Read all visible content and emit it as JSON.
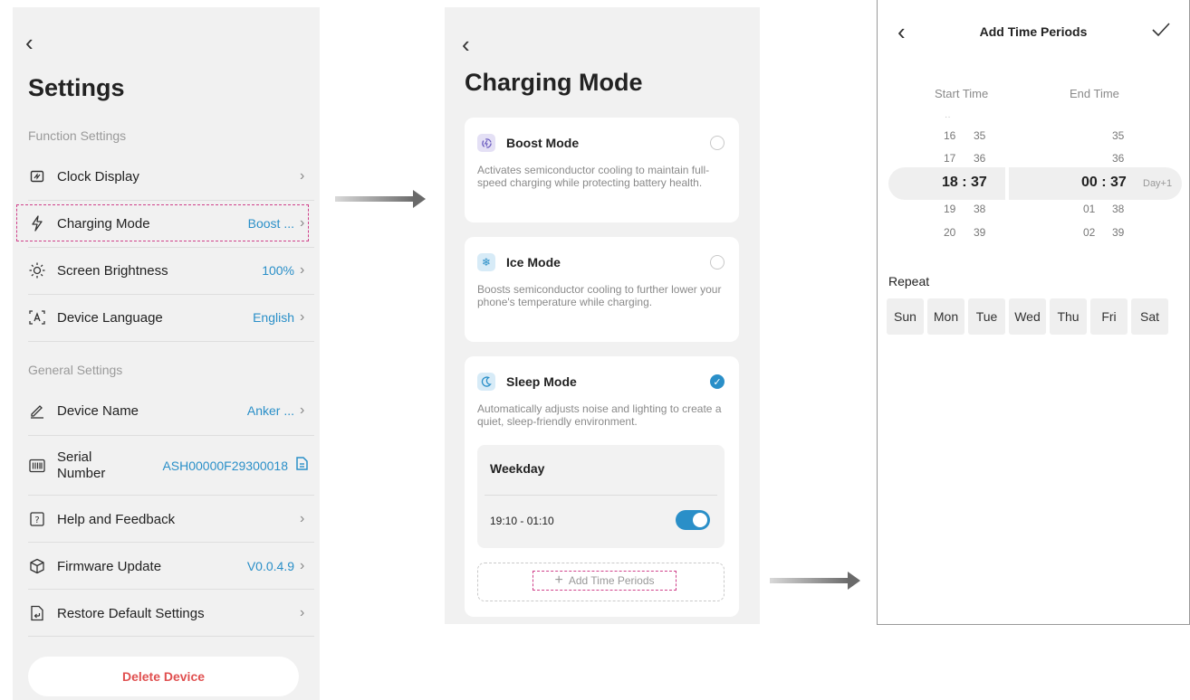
{
  "settings": {
    "title": "Settings",
    "function_section": "Function Settings",
    "general_section": "General Settings",
    "items": [
      {
        "label": "Clock Display",
        "value": ""
      },
      {
        "label": "Charging Mode",
        "value": "Boost ..."
      },
      {
        "label": "Screen Brightness",
        "value": "100%"
      },
      {
        "label": "Device Language",
        "value": "English"
      },
      {
        "label": "Device Name",
        "value": "Anker ..."
      },
      {
        "label_line1": "Serial",
        "label_line2": "Number",
        "value": "ASH00000F29300018"
      },
      {
        "label": "Help and Feedback",
        "value": ""
      },
      {
        "label": "Firmware Update",
        "value": "V0.0.4.9"
      },
      {
        "label": "Restore Default Settings",
        "value": ""
      }
    ],
    "delete_label": "Delete Device"
  },
  "charging": {
    "title": "Charging Mode",
    "modes": [
      {
        "title": "Boost Mode",
        "desc": "Activates semiconductor cooling to maintain full-speed charging while protecting battery health.",
        "selected": false
      },
      {
        "title": "Ice Mode",
        "desc": "Boosts semiconductor cooling to further lower your phone's temperature while charging.",
        "selected": false
      },
      {
        "title": "Sleep Mode",
        "desc": "Automatically adjusts noise and lighting to create a quiet, sleep-friendly environment.",
        "selected": true
      }
    ],
    "schedule": {
      "day": "Weekday",
      "time": "19:10 - 01:10",
      "enabled": true
    },
    "add_label": "Add Time Periods"
  },
  "periods": {
    "title": "Add Time Periods",
    "start_label": "Start Time",
    "end_label": "End Time",
    "start_hours": [
      "16",
      "17",
      "19",
      "20"
    ],
    "start_minutes": [
      "35",
      "36",
      "38",
      "39"
    ],
    "end_hours": [
      "01",
      "02"
    ],
    "end_minutes": [
      "35",
      "36",
      "38",
      "39"
    ],
    "start_selected": "18 : 37",
    "end_selected": "00 : 37",
    "end_suffix": "Day+1",
    "repeat_label": "Repeat",
    "days": [
      "Sun",
      "Mon",
      "Tue",
      "Wed",
      "Thu",
      "Fri",
      "Sat"
    ]
  },
  "colors": {
    "accent": "#2a8fc8",
    "danger": "#e05050",
    "highlight": "#d0408a"
  }
}
